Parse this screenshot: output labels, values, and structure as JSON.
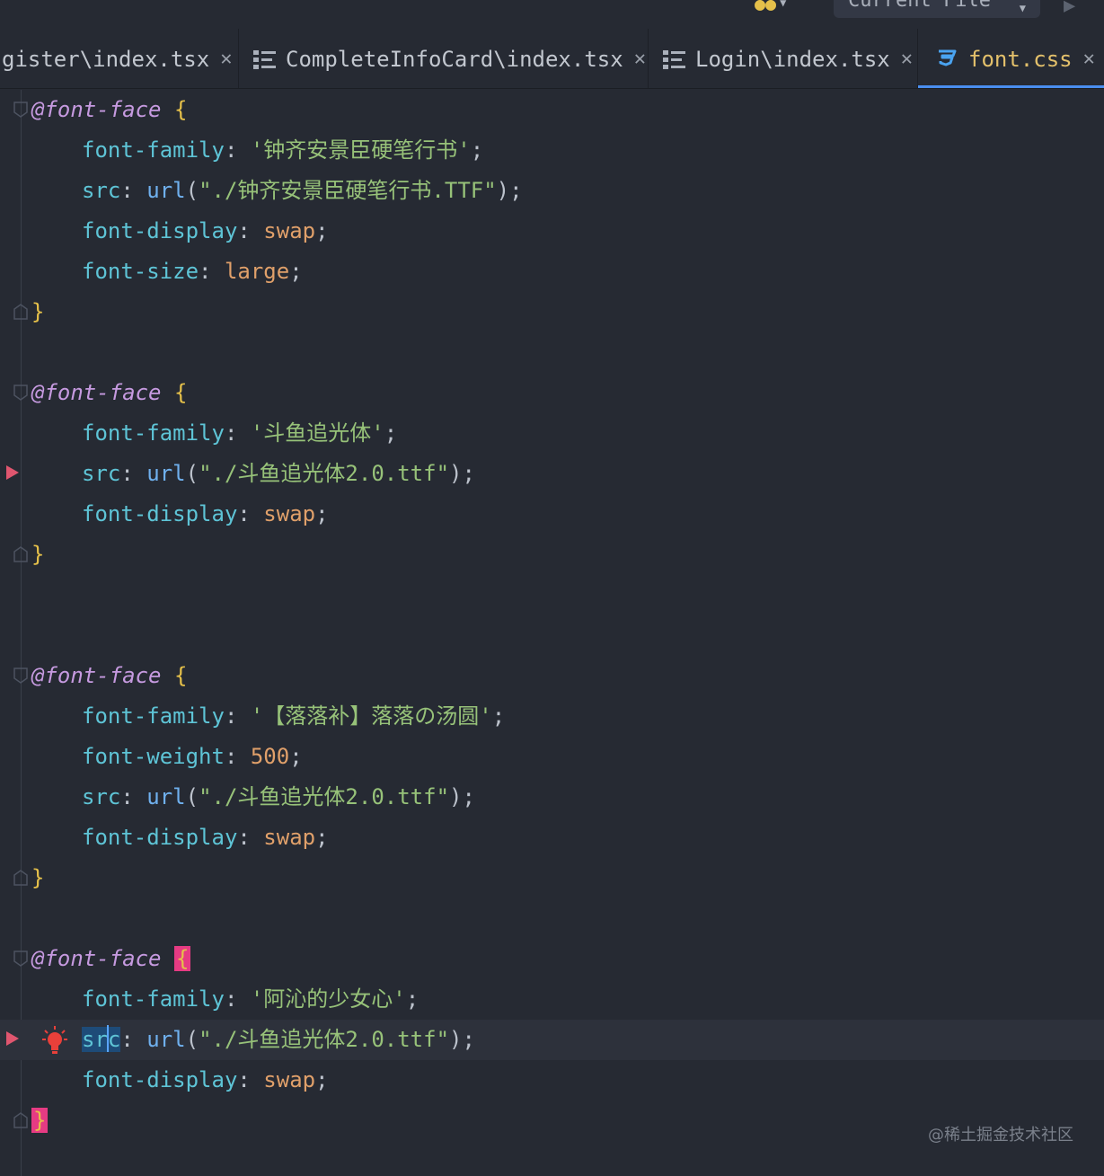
{
  "toolbar": {
    "run_config_label": "Current File"
  },
  "tabs": [
    {
      "label": "gister\\index.tsx",
      "icon": "structure-icon",
      "active": false
    },
    {
      "label": "CompleteInfoCard\\index.tsx",
      "icon": "structure-icon",
      "active": false
    },
    {
      "label": "Login\\index.tsx",
      "icon": "structure-icon",
      "active": false
    },
    {
      "label": "font.css",
      "icon": "css-icon",
      "active": true
    }
  ],
  "code": {
    "blocks": [
      {
        "at_rule": "@font-face",
        "open_brace": "{",
        "close_brace": "}",
        "decls": [
          {
            "prop": "font-family",
            "colon": ": ",
            "value": "'钟齐安景臣硬笔行书'",
            "value_kind": "str",
            "semi": ";"
          },
          {
            "prop": "src",
            "colon": ": ",
            "fn": "url",
            "fn_arg": "\"./钟齐安景臣硬笔行书.TTF\"",
            "semi": ";"
          },
          {
            "prop": "font-display",
            "colon": ": ",
            "value": "swap",
            "value_kind": "val",
            "semi": ";"
          },
          {
            "prop": "font-size",
            "colon": ": ",
            "value": "large",
            "value_kind": "val",
            "semi": ";"
          }
        ]
      },
      {
        "at_rule": "@font-face",
        "open_brace": "{",
        "close_brace": "}",
        "decls": [
          {
            "prop": "font-family",
            "colon": ": ",
            "value": "'斗鱼追光体'",
            "value_kind": "str",
            "semi": ";"
          },
          {
            "prop": "src",
            "colon": ": ",
            "fn": "url",
            "fn_arg": "\"./斗鱼追光体2.0.ttf\"",
            "semi": ";"
          },
          {
            "prop": "font-display",
            "colon": ": ",
            "value": "swap",
            "value_kind": "val",
            "semi": ";"
          }
        ]
      },
      {
        "at_rule": "@font-face",
        "open_brace": "{",
        "close_brace": "}",
        "decls": [
          {
            "prop": "font-family",
            "colon": ": ",
            "value": "'【落落补】落落の汤圆'",
            "value_kind": "str",
            "semi": ";"
          },
          {
            "prop": "font-weight",
            "colon": ": ",
            "value": "500",
            "value_kind": "num",
            "semi": ";"
          },
          {
            "prop": "src",
            "colon": ": ",
            "fn": "url",
            "fn_arg": "\"./斗鱼追光体2.0.ttf\"",
            "semi": ";"
          },
          {
            "prop": "font-display",
            "colon": ": ",
            "value": "swap",
            "value_kind": "val",
            "semi": ";"
          }
        ]
      },
      {
        "at_rule": "@font-face",
        "open_brace": "{",
        "close_brace": "}",
        "decls": [
          {
            "prop": "font-family",
            "colon": ": ",
            "value": "'阿沁的少女心'",
            "value_kind": "str",
            "semi": ";"
          },
          {
            "prop_before_caret": "sr",
            "prop_after_caret": "c",
            "colon": ": ",
            "fn": "url",
            "fn_arg": "\"./斗鱼追光体2.0.ttf\"",
            "semi": ";"
          },
          {
            "prop": "font-display",
            "colon": ": ",
            "value": "swap",
            "value_kind": "val",
            "semi": ";"
          }
        ]
      }
    ]
  },
  "colors": {
    "background": "#262a33",
    "at_rule": "#c69ae0",
    "property": "#5ec4d6",
    "string": "#97c279",
    "function": "#6fb0ee",
    "value": "#e0a06a",
    "brace": "#e5c04a",
    "brace_match_highlight": "#e63b83",
    "active_tab_underline": "#4a8ef0",
    "breakpoint": "#e0566f"
  },
  "watermark": "@稀土掘金技术社区"
}
